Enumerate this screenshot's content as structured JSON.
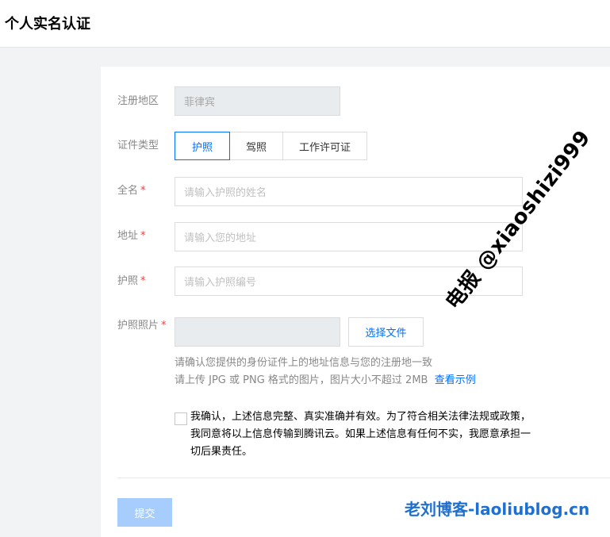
{
  "header": {
    "title": "个人实名认证"
  },
  "form": {
    "region": {
      "label": "注册地区",
      "value": "菲律宾"
    },
    "doc_type": {
      "label": "证件类型",
      "options": [
        "护照",
        "驾照",
        "工作许可证"
      ],
      "selected": "护照"
    },
    "full_name": {
      "label": "全名",
      "required_mark": "*",
      "placeholder": "请输入护照的姓名"
    },
    "address": {
      "label": "地址",
      "required_mark": "*",
      "placeholder": "请输入您的地址"
    },
    "passport": {
      "label": "护照",
      "required_mark": "*",
      "placeholder": "请输入护照编号"
    },
    "photo": {
      "label": "护照照片",
      "required_mark": "*",
      "choose_button": "选择文件"
    },
    "hints": {
      "line1": "请确认您提供的身份证件上的地址信息与您的注册地一致",
      "line2": "请上传 JPG 或 PNG 格式的图片，图片大小不超过 2MB",
      "example_link": "查看示例"
    },
    "agreement": {
      "line1": "我确认，上述信息完整、真实准确并有效。为了符合相关法律法规或政策，",
      "line2": "我同意将以上信息传输到腾讯云。如果上述信息有任何不实，我愿意承担一",
      "line3": "切后果责任。",
      "checked": false
    },
    "submit_label": "提交"
  },
  "watermark": "电报 @xiaoshizi999",
  "brand_watermark": "老刘博客-laoliublog.cn",
  "colors": {
    "accent": "#006eff",
    "required": "#e54545",
    "submit_disabled": "#a7cdfd",
    "brand": "#1f6fd1"
  }
}
